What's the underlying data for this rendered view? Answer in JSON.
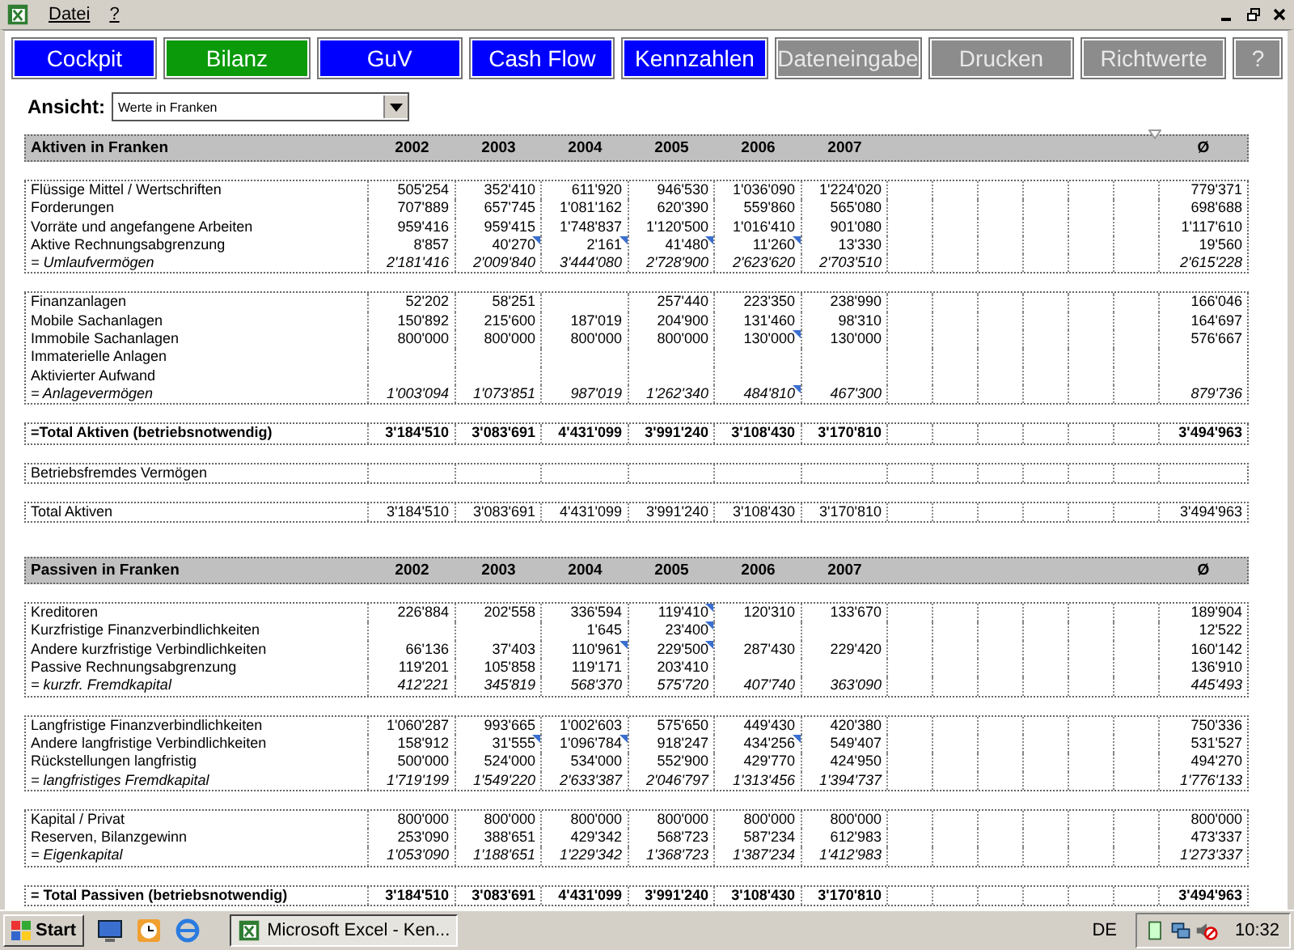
{
  "menu_bar": {
    "items": [
      "Datei",
      "?"
    ]
  },
  "nav_buttons": [
    {
      "label": "Cockpit",
      "kind": "nav",
      "selected": false
    },
    {
      "label": "Bilanz",
      "kind": "nav",
      "selected": true
    },
    {
      "label": "GuV",
      "kind": "nav",
      "selected": false
    },
    {
      "label": "Cash Flow",
      "kind": "nav",
      "selected": false
    },
    {
      "label": "Kennzahlen",
      "kind": "nav",
      "selected": false
    },
    {
      "label": "Dateneingabe",
      "kind": "tool",
      "selected": false
    },
    {
      "label": "Drucken",
      "kind": "tool",
      "selected": false
    },
    {
      "label": "Richtwerte",
      "kind": "tool",
      "selected": false
    },
    {
      "label": "?",
      "kind": "tool",
      "selected": false
    }
  ],
  "view": {
    "label": "Ansicht:",
    "value": "Werte in Franken"
  },
  "sections": [
    {
      "title": "Aktiven in Franken",
      "years": [
        "2002",
        "2003",
        "2004",
        "2005",
        "2006",
        "2007"
      ],
      "avg_label": "Ø",
      "groups": [
        [
          {
            "label": "Flüssige Mittel / Wertschriften",
            "kind": "item",
            "cells": [
              {
                "text": "505'254",
                "comment": false
              },
              {
                "text": "352'410",
                "comment": false
              },
              {
                "text": "611'920",
                "comment": false
              },
              {
                "text": "946'530",
                "comment": false
              },
              {
                "text": "1'036'090",
                "comment": false
              },
              {
                "text": "1'224'020",
                "comment": false
              }
            ],
            "avg": "779'371"
          },
          {
            "label": "Forderungen",
            "kind": "item",
            "cells": [
              {
                "text": "707'889",
                "comment": false
              },
              {
                "text": "657'745",
                "comment": false
              },
              {
                "text": "1'081'162",
                "comment": false
              },
              {
                "text": "620'390",
                "comment": false
              },
              {
                "text": "559'860",
                "comment": false
              },
              {
                "text": "565'080",
                "comment": false
              }
            ],
            "avg": "698'688"
          },
          {
            "label": "Vorräte und angefangene Arbeiten",
            "kind": "item",
            "cells": [
              {
                "text": "959'416",
                "comment": false
              },
              {
                "text": "959'415",
                "comment": false
              },
              {
                "text": "1'748'837",
                "comment": false
              },
              {
                "text": "1'120'500",
                "comment": false
              },
              {
                "text": "1'016'410",
                "comment": false
              },
              {
                "text": "901'080",
                "comment": false
              }
            ],
            "avg": "1'117'610"
          },
          {
            "label": "Aktive Rechnungsabgrenzung",
            "kind": "item",
            "cells": [
              {
                "text": "8'857",
                "comment": false
              },
              {
                "text": "40'270",
                "comment": true
              },
              {
                "text": "2'161",
                "comment": true
              },
              {
                "text": "41'480",
                "comment": true
              },
              {
                "text": "11'260",
                "comment": true
              },
              {
                "text": "13'330",
                "comment": false
              }
            ],
            "avg": "19'560"
          },
          {
            "label": "= Umlaufvermögen",
            "kind": "subtotal",
            "cells": [
              {
                "text": "2'181'416",
                "comment": false
              },
              {
                "text": "2'009'840",
                "comment": false
              },
              {
                "text": "3'444'080",
                "comment": false
              },
              {
                "text": "2'728'900",
                "comment": false
              },
              {
                "text": "2'623'620",
                "comment": false
              },
              {
                "text": "2'703'510",
                "comment": false
              }
            ],
            "avg": "2'615'228"
          }
        ],
        [
          {
            "label": "Finanzanlagen",
            "kind": "item",
            "cells": [
              {
                "text": "52'202",
                "comment": false
              },
              {
                "text": "58'251",
                "comment": false
              },
              {
                "comment": false
              },
              {
                "text": "257'440",
                "comment": false
              },
              {
                "text": "223'350",
                "comment": false
              },
              {
                "text": "238'990",
                "comment": false
              }
            ],
            "avg": "166'046"
          },
          {
            "label": "Mobile Sachanlagen",
            "kind": "item",
            "cells": [
              {
                "text": "150'892",
                "comment": false
              },
              {
                "text": "215'600",
                "comment": false
              },
              {
                "text": "187'019",
                "comment": false
              },
              {
                "text": "204'900",
                "comment": false
              },
              {
                "text": "131'460",
                "comment": false
              },
              {
                "text": "98'310",
                "comment": false
              }
            ],
            "avg": "164'697"
          },
          {
            "label": "Immobile Sachanlagen",
            "kind": "item",
            "cells": [
              {
                "text": "800'000",
                "comment": false
              },
              {
                "text": "800'000",
                "comment": false
              },
              {
                "text": "800'000",
                "comment": false
              },
              {
                "text": "800'000",
                "comment": false
              },
              {
                "text": "130'000",
                "comment": true
              },
              {
                "text": "130'000",
                "comment": false
              }
            ],
            "avg": "576'667"
          },
          {
            "label": "Immaterielle Anlagen",
            "kind": "item",
            "cells": [
              {
                "comment": false
              },
              {
                "comment": false
              },
              {
                "comment": false
              },
              {
                "comment": false
              },
              {
                "comment": false
              },
              {
                "comment": false
              }
            ]
          },
          {
            "label": "Aktivierter Aufwand",
            "kind": "item",
            "cells": [
              {
                "comment": false
              },
              {
                "comment": false
              },
              {
                "comment": false
              },
              {
                "comment": false
              },
              {
                "comment": false
              },
              {
                "comment": false
              }
            ]
          },
          {
            "label": "= Anlagevermögen",
            "kind": "subtotal",
            "cells": [
              {
                "text": "1'003'094",
                "comment": false
              },
              {
                "text": "1'073'851",
                "comment": false
              },
              {
                "text": "987'019",
                "comment": false
              },
              {
                "text": "1'262'340",
                "comment": false
              },
              {
                "text": "484'810",
                "comment": true
              },
              {
                "text": "467'300",
                "comment": false
              }
            ],
            "avg": "879'736"
          }
        ],
        [
          {
            "label": "=Total Aktiven (betriebsnotwendig)",
            "kind": "total",
            "cells": [
              {
                "text": "3'184'510",
                "comment": false
              },
              {
                "text": "3'083'691",
                "comment": false
              },
              {
                "text": "4'431'099",
                "comment": false
              },
              {
                "text": "3'991'240",
                "comment": false
              },
              {
                "text": "3'108'430",
                "comment": false
              },
              {
                "text": "3'170'810",
                "comment": false
              }
            ],
            "avg": "3'494'963"
          }
        ],
        [
          {
            "label": "Betriebsfremdes Vermögen",
            "kind": "item",
            "cells": [
              {
                "comment": false
              },
              {
                "comment": false
              },
              {
                "comment": false
              },
              {
                "comment": false
              },
              {
                "comment": false
              },
              {
                "comment": false
              }
            ]
          }
        ],
        [
          {
            "label": "Total Aktiven",
            "kind": "item",
            "cells": [
              {
                "text": "3'184'510",
                "comment": false
              },
              {
                "text": "3'083'691",
                "comment": false
              },
              {
                "text": "4'431'099",
                "comment": false
              },
              {
                "text": "3'991'240",
                "comment": false
              },
              {
                "text": "3'108'430",
                "comment": false
              },
              {
                "text": "3'170'810",
                "comment": false
              }
            ],
            "avg": "3'494'963"
          }
        ]
      ]
    },
    {
      "title": "Passiven in Franken",
      "years": [
        "2002",
        "2003",
        "2004",
        "2005",
        "2006",
        "2007"
      ],
      "avg_label": "Ø",
      "groups": [
        [
          {
            "label": "Kreditoren",
            "kind": "item",
            "cells": [
              {
                "text": "226'884",
                "comment": false
              },
              {
                "text": "202'558",
                "comment": false
              },
              {
                "text": "336'594",
                "comment": false
              },
              {
                "text": "119'410",
                "comment": true
              },
              {
                "text": "120'310",
                "comment": false
              },
              {
                "text": "133'670",
                "comment": false
              }
            ],
            "avg": "189'904"
          },
          {
            "label": "Kurzfristige Finanzverbindlichkeiten",
            "kind": "item",
            "cells": [
              {
                "comment": false
              },
              {
                "comment": false
              },
              {
                "text": "1'645",
                "comment": false
              },
              {
                "text": "23'400",
                "comment": true
              },
              {
                "comment": false
              },
              {
                "comment": false
              }
            ],
            "avg": "12'522"
          },
          {
            "label": "Andere kurzfristige Verbindlichkeiten",
            "kind": "item",
            "cells": [
              {
                "text": "66'136",
                "comment": false
              },
              {
                "text": "37'403",
                "comment": false
              },
              {
                "text": "110'961",
                "comment": true
              },
              {
                "text": "229'500",
                "comment": true
              },
              {
                "text": "287'430",
                "comment": false
              },
              {
                "text": "229'420",
                "comment": false
              }
            ],
            "avg": "160'142"
          },
          {
            "label": "Passive Rechnungsabgrenzung",
            "kind": "item",
            "cells": [
              {
                "text": "119'201",
                "comment": false
              },
              {
                "text": "105'858",
                "comment": false
              },
              {
                "text": "119'171",
                "comment": false
              },
              {
                "text": "203'410",
                "comment": false
              },
              {
                "comment": false
              },
              {
                "comment": false
              }
            ],
            "avg": "136'910"
          },
          {
            "label": "= kurzfr. Fremdkapital",
            "kind": "subtotal",
            "cells": [
              {
                "text": "412'221",
                "comment": false
              },
              {
                "text": "345'819",
                "comment": false
              },
              {
                "text": "568'370",
                "comment": false
              },
              {
                "text": "575'720",
                "comment": false
              },
              {
                "text": "407'740",
                "comment": false
              },
              {
                "text": "363'090",
                "comment": false
              }
            ],
            "avg": "445'493"
          }
        ],
        [
          {
            "label": "Langfristige Finanzverbindlichkeiten",
            "kind": "item",
            "cells": [
              {
                "text": "1'060'287",
                "comment": false
              },
              {
                "text": "993'665",
                "comment": false
              },
              {
                "text": "1'002'603",
                "comment": false
              },
              {
                "text": "575'650",
                "comment": false
              },
              {
                "text": "449'430",
                "comment": false
              },
              {
                "text": "420'380",
                "comment": false
              }
            ],
            "avg": "750'336"
          },
          {
            "label": "Andere langfristige Verbindlichkeiten",
            "kind": "item",
            "cells": [
              {
                "text": "158'912",
                "comment": false
              },
              {
                "text": "31'555",
                "comment": true
              },
              {
                "text": "1'096'784",
                "comment": true
              },
              {
                "text": "918'247",
                "comment": false
              },
              {
                "text": "434'256",
                "comment": true
              },
              {
                "text": "549'407",
                "comment": false
              }
            ],
            "avg": "531'527"
          },
          {
            "label": "Rückstellungen langfristig",
            "kind": "item",
            "cells": [
              {
                "text": "500'000",
                "comment": false
              },
              {
                "text": "524'000",
                "comment": false
              },
              {
                "text": "534'000",
                "comment": false
              },
              {
                "text": "552'900",
                "comment": false
              },
              {
                "text": "429'770",
                "comment": false
              },
              {
                "text": "424'950",
                "comment": false
              }
            ],
            "avg": "494'270"
          },
          {
            "label": "= langfristiges Fremdkapital",
            "kind": "subtotal",
            "cells": [
              {
                "text": "1'719'199",
                "comment": false
              },
              {
                "text": "1'549'220",
                "comment": false
              },
              {
                "text": "2'633'387",
                "comment": false
              },
              {
                "text": "2'046'797",
                "comment": false
              },
              {
                "text": "1'313'456",
                "comment": false
              },
              {
                "text": "1'394'737",
                "comment": false
              }
            ],
            "avg": "1'776'133"
          }
        ],
        [
          {
            "label": "Kapital / Privat",
            "kind": "item",
            "cells": [
              {
                "text": "800'000",
                "comment": false
              },
              {
                "text": "800'000",
                "comment": false
              },
              {
                "text": "800'000",
                "comment": false
              },
              {
                "text": "800'000",
                "comment": false
              },
              {
                "text": "800'000",
                "comment": false
              },
              {
                "text": "800'000",
                "comment": false
              }
            ],
            "avg": "800'000"
          },
          {
            "label": "Reserven, Bilanzgewinn",
            "kind": "item",
            "cells": [
              {
                "text": "253'090",
                "comment": false
              },
              {
                "text": "388'651",
                "comment": false
              },
              {
                "text": "429'342",
                "comment": false
              },
              {
                "text": "568'723",
                "comment": false
              },
              {
                "text": "587'234",
                "comment": false
              },
              {
                "text": "612'983",
                "comment": false
              }
            ],
            "avg": "473'337"
          },
          {
            "label": "= Eigenkapital",
            "kind": "subtotal",
            "cells": [
              {
                "text": "1'053'090",
                "comment": false
              },
              {
                "text": "1'188'651",
                "comment": false
              },
              {
                "text": "1'229'342",
                "comment": false
              },
              {
                "text": "1'368'723",
                "comment": false
              },
              {
                "text": "1'387'234",
                "comment": false
              },
              {
                "text": "1'412'983",
                "comment": false
              }
            ],
            "avg": "1'273'337"
          }
        ],
        [
          {
            "label": "= Total Passiven (betriebsnotwendig)",
            "kind": "total",
            "cells": [
              {
                "text": "3'184'510",
                "comment": false
              },
              {
                "text": "3'083'691",
                "comment": false
              },
              {
                "text": "4'431'099",
                "comment": false
              },
              {
                "text": "3'991'240",
                "comment": false
              },
              {
                "text": "3'108'430",
                "comment": false
              },
              {
                "text": "3'170'810",
                "comment": false
              }
            ],
            "avg": "3'494'963"
          }
        ]
      ]
    }
  ],
  "taskbar": {
    "start": "Start",
    "task": "Microsoft Excel - Ken...",
    "language": "DE",
    "time": "10:32"
  }
}
